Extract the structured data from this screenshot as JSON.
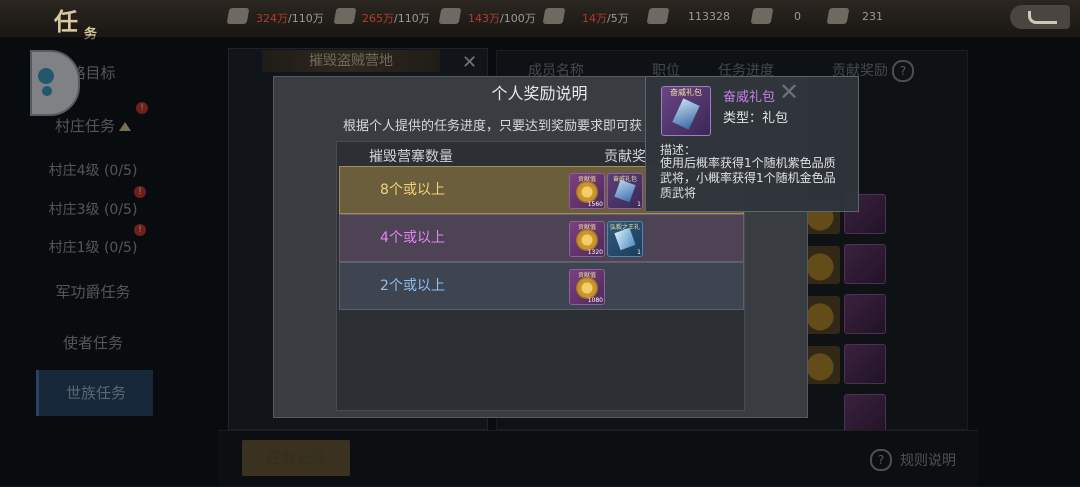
{
  "header": {
    "title": "任",
    "title_small": "务",
    "resources": [
      {
        "icon": "grain-icon",
        "value": "324万",
        "cap": "/110万"
      },
      {
        "icon": "wood-icon",
        "value": "265万",
        "cap": "/110万"
      },
      {
        "icon": "stone-icon",
        "value": "143万",
        "cap": "/100万"
      },
      {
        "icon": "iron-icon",
        "value": "14万",
        "cap": "/5万"
      },
      {
        "icon": "feather-icon",
        "value": "113328",
        "cap": ""
      },
      {
        "icon": "crown-icon",
        "value": "0",
        "cap": ""
      },
      {
        "icon": "crown-icon",
        "value": "231",
        "cap": ""
      }
    ]
  },
  "sidebar": {
    "items": [
      {
        "label": "略目标"
      },
      {
        "label": "村庄任务"
      },
      {
        "label": "村庄4级 (0/5)"
      },
      {
        "label": "村庄3级 (0/5)"
      },
      {
        "label": "村庄1级 (0/5)"
      },
      {
        "label": "军功爵任务"
      },
      {
        "label": "使者任务"
      },
      {
        "label": "世族任务"
      }
    ],
    "badge": "!"
  },
  "left_panel": {
    "title": "摧毁盗贼营地"
  },
  "right_panel": {
    "columns": [
      "成员名称",
      "职位",
      "任务进度",
      "贡献奖励"
    ]
  },
  "bottom": {
    "record_button": "任务记录",
    "rules_link": "规则说明"
  },
  "modal": {
    "title": "个人奖励说明",
    "subtitle": "根据个人提供的任务进度，只要达到奖励要求即可获",
    "col_count": "摧毁营寨数量",
    "col_reward": "贡献奖",
    "rows": [
      {
        "label": "8个或以上",
        "items": [
          {
            "tag": "贡献值",
            "count": "1560"
          },
          {
            "tag": "奋威礼包",
            "count": "1"
          }
        ]
      },
      {
        "label": "4个或以上",
        "items": [
          {
            "tag": "贡献值",
            "count": "1320"
          },
          {
            "tag": "弘毅之王礼包",
            "count": "1"
          }
        ]
      },
      {
        "label": "2个或以上",
        "items": [
          {
            "tag": "贡献值",
            "count": "1080"
          }
        ]
      }
    ]
  },
  "tooltip": {
    "icon_tag": "奋威礼包",
    "name": "奋威礼包",
    "type": "类型：礼包",
    "desc_label": "描述：",
    "desc": "使用后概率获得1个随机紫色品质武将，小概率获得1个随机金色品质武将"
  },
  "colors": {
    "gold_text": "#f3d27a",
    "purple_text": "#e287f2",
    "blue_text": "#8fbef0",
    "item_name": "#c87ee8",
    "badge": "#c83a30"
  }
}
